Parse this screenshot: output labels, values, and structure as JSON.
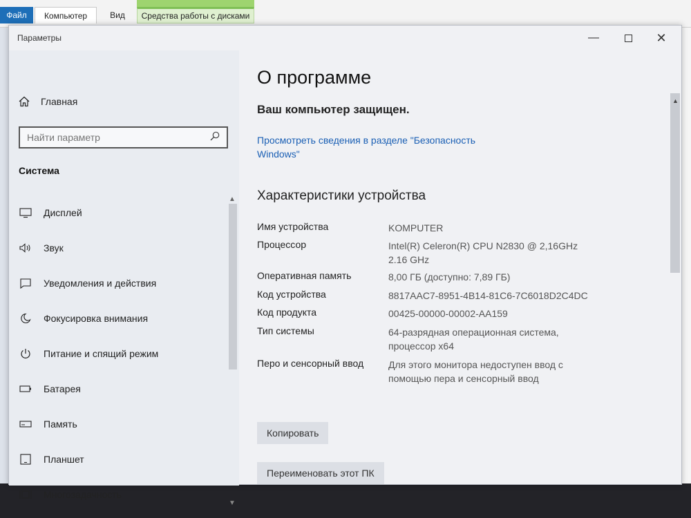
{
  "explorer": {
    "tabs": [
      "Файл",
      "Компьютер",
      "Вид",
      "Средства работы с дисками"
    ]
  },
  "window": {
    "title": "Параметры"
  },
  "sidebar": {
    "home_label": "Главная",
    "search_placeholder": "Найти параметр",
    "section_title": "Система",
    "items": [
      {
        "label": "Дисплей",
        "icon": "display-icon"
      },
      {
        "label": "Звук",
        "icon": "sound-icon"
      },
      {
        "label": "Уведомления и действия",
        "icon": "notifications-icon"
      },
      {
        "label": "Фокусировка внимания",
        "icon": "focus-moon-icon"
      },
      {
        "label": "Питание и спящий режим",
        "icon": "power-icon"
      },
      {
        "label": "Батарея",
        "icon": "battery-icon"
      },
      {
        "label": "Память",
        "icon": "storage-icon"
      },
      {
        "label": "Планшет",
        "icon": "tablet-icon"
      },
      {
        "label": "Многозадачность",
        "icon": "multitasking-icon"
      }
    ]
  },
  "main": {
    "title": "О программе",
    "protected_text": "Ваш компьютер защищен.",
    "security_link": "Просмотреть сведения в разделе \"Безопасность Windows\"",
    "device_specs_title": "Характеристики устройства",
    "specs": [
      {
        "label": "Имя устройства",
        "value": "KOMPUTER"
      },
      {
        "label": "Процессор",
        "value": "Intel(R) Celeron(R) CPU N2830 @ 2,16GHz 2.16 GHz"
      },
      {
        "label": "Оперативная память",
        "value": "8,00 ГБ (доступно: 7,89 ГБ)"
      },
      {
        "label": "Код устройства",
        "value": "8817AAC7-8951-4B14-81C6-7C6018D2C4DC"
      },
      {
        "label": "Код продукта",
        "value": "00425-00000-00002-AA159"
      },
      {
        "label": "Тип системы",
        "value": "64-разрядная операционная система, процессор x64"
      },
      {
        "label": "Перо и сенсорный ввод",
        "value": "Для этого монитора недоступен ввод с помощью пера и сенсорный ввод"
      }
    ],
    "copy_button": "Копировать",
    "rename_button": "Переименовать этот ПК"
  }
}
